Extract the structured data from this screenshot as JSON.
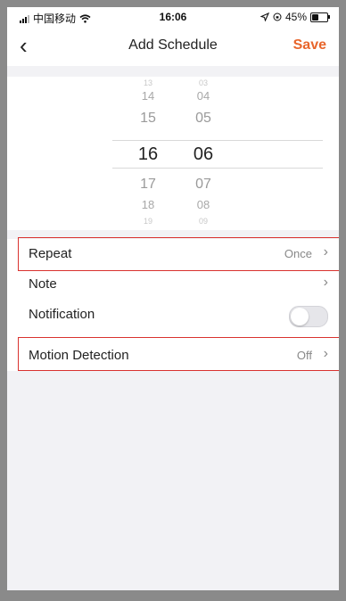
{
  "status_bar": {
    "carrier": "中国移动",
    "wifi_icon": "wifi-icon",
    "time": "16:06",
    "location_icon": "location-arrow-icon",
    "lock_icon": "orientation-lock-icon",
    "battery_percent": "45%",
    "battery_level": 0.45
  },
  "nav": {
    "back_icon": "chevron-left-icon",
    "back_glyph": "‹",
    "title": "Add Schedule",
    "save_label": "Save",
    "accent": "#e8652b"
  },
  "picker": {
    "hours": [
      "13",
      "14",
      "15",
      "16",
      "17",
      "18",
      "19"
    ],
    "minutes": [
      "03",
      "04",
      "05",
      "06",
      "07",
      "08",
      "09"
    ],
    "selected_hour": "16",
    "selected_minute": "06"
  },
  "settings": {
    "repeat": {
      "label": "Repeat",
      "value": "Once"
    },
    "note": {
      "label": "Note",
      "value": ""
    },
    "notification": {
      "label": "Notification",
      "enabled": false
    },
    "motion": {
      "label": "Motion Detection",
      "value": "Off"
    },
    "chevron_glyph": "›"
  }
}
